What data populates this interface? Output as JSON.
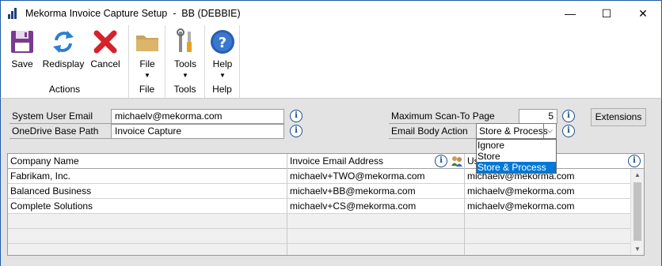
{
  "window": {
    "title": "Mekorma Invoice Capture Setup  -  BB (DEBBIE)",
    "minimize": "—",
    "maximize": "☐",
    "close": "✕"
  },
  "ribbon": {
    "groups": [
      {
        "label": "Actions",
        "buttons": [
          {
            "label": "Save",
            "icon": "save-icon"
          },
          {
            "label": "Redisplay",
            "icon": "refresh-icon"
          },
          {
            "label": "Cancel",
            "icon": "cancel-icon"
          }
        ]
      },
      {
        "label": "File",
        "buttons": [
          {
            "label": "File",
            "icon": "folder-icon"
          }
        ]
      },
      {
        "label": "Tools",
        "buttons": [
          {
            "label": "Tools",
            "icon": "tools-icon"
          }
        ]
      },
      {
        "label": "Help",
        "buttons": [
          {
            "label": "Help",
            "icon": "help-icon"
          }
        ]
      }
    ],
    "caret": "▼"
  },
  "form": {
    "system_user_email_label": "System User Email",
    "system_user_email_value": "michaelv@mekorma.com",
    "onedrive_base_path_label": "OneDrive Base Path",
    "onedrive_base_path_value": "Invoice Capture",
    "max_scan_label": "Maximum Scan-To Page",
    "max_scan_value": "5",
    "email_body_action_label": "Email Body Action",
    "email_body_action_value": "Store & Process",
    "email_body_action_options": [
      "Ignore",
      "Store",
      "Store & Process"
    ],
    "extensions_button": "Extensions",
    "info_glyph": "i",
    "dropdown_arrow": "⌵"
  },
  "grid": {
    "headers": [
      "Company Name",
      "Invoice Email Address",
      "Us"
    ],
    "rows": [
      {
        "company": "Fabrikam, Inc.",
        "invoice_email": "michaelv+TWO@mekorma.com",
        "user_email": "michaelv@mekorma.com"
      },
      {
        "company": "Balanced Business",
        "invoice_email": "michaelv+BB@mekorma.com",
        "user_email": "michaelv@mekorma.com"
      },
      {
        "company": "Complete Solutions",
        "invoice_email": "michaelv+CS@mekorma.com",
        "user_email": "michaelv@mekorma.com"
      }
    ],
    "scroll_up": "▲",
    "scroll_down": "▼"
  },
  "colors": {
    "accent": "#1e5aa8",
    "selection": "#0078d7",
    "form_background": "#e3e3e3",
    "save_icon": "#7a3b8f",
    "refresh_icon": "#2a7fd4",
    "cancel_icon": "#d4232a",
    "help_icon": "#2a5db0"
  }
}
